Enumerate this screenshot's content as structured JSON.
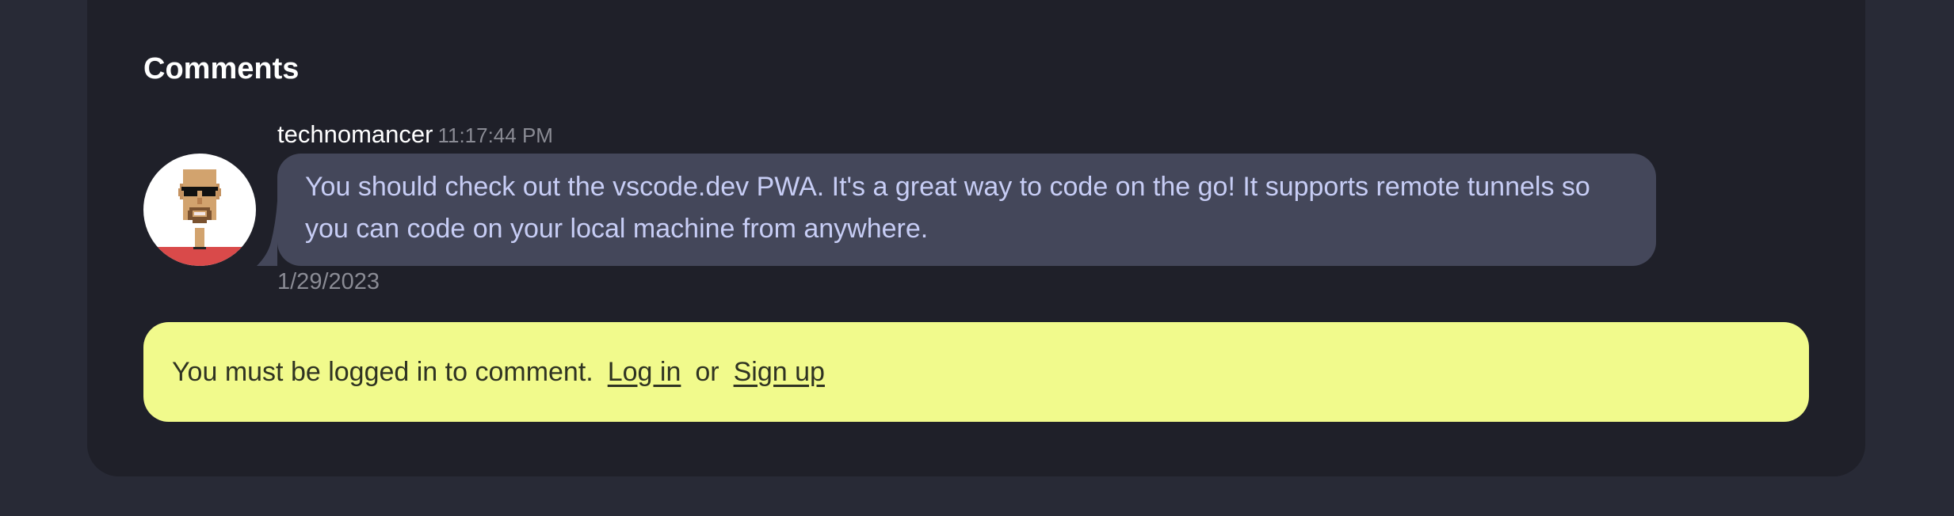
{
  "comments": {
    "heading": "Comments",
    "items": [
      {
        "author": "technomancer",
        "time": "11:17:44 PM",
        "text": "You should check out the vscode.dev PWA. It's a great way to code on the go! It supports remote tunnels so you can code on your local machine from anywhere.",
        "date": "1/29/2023",
        "avatar_icon": "pixel-art-avatar-icon"
      }
    ]
  },
  "login_notice": {
    "text": "You must be logged in to comment.",
    "login_label": "Log in",
    "or_text": "or",
    "signup_label": "Sign up"
  },
  "colors": {
    "page_bg": "#282a36",
    "card_bg": "#1f2029",
    "bubble_bg": "#44475a",
    "bubble_text": "#c7cdf5",
    "notice_bg": "#f1fa8c",
    "notice_text": "#2f3322"
  }
}
